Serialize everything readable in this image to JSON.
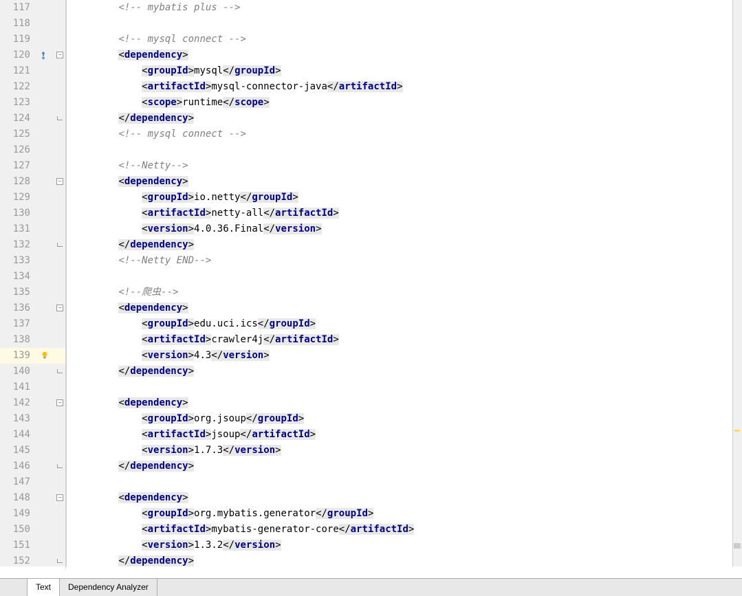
{
  "startLine": 117,
  "highlightLine": 139,
  "tabs": {
    "text": "Text",
    "dep": "Dependency Analyzer"
  },
  "tokens": {
    "dep": "dependency",
    "gid": "groupId",
    "aid": "artifactId",
    "ver": "version",
    "scp": "scope"
  },
  "vals": {
    "c1": "<!-- mybatis plus -->",
    "c2": "<!-- mysql connect -->",
    "c3": "<!-- mysql connect -->",
    "c4": "<!--Netty-->",
    "c5": "<!--Netty END-->",
    "c6": "<!--爬虫-->",
    "g1": "mysql",
    "a1": "mysql-connector-java",
    "s1": "runtime",
    "g2": "io.netty",
    "a2": "netty-all",
    "v2": "4.0.36.Final",
    "g3": "edu.uci.ics",
    "a3": "crawler4j",
    "v3": "4.3",
    "g4": "org.jsoup",
    "a4": "jsoup",
    "v4": "1.7.3",
    "g5": "org.mybatis.generator",
    "a5": "mybatis-generator-core",
    "v5": "1.3.2"
  }
}
